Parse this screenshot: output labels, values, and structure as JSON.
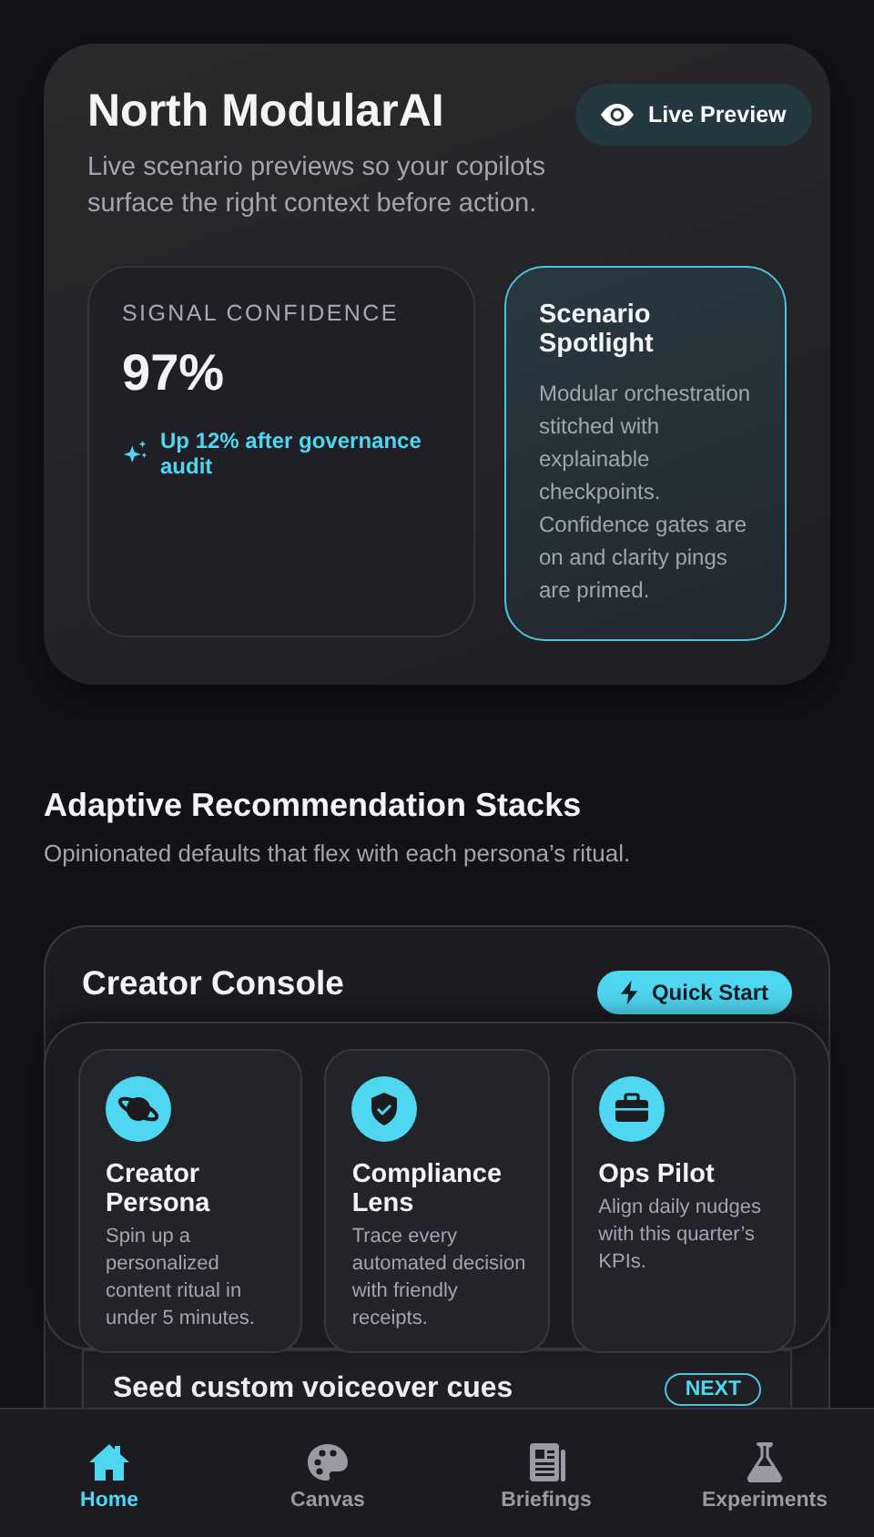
{
  "header": {
    "title": "North ModularAI",
    "subtitle": "Live scenario previews so your copilots surface the right context before action.",
    "action": {
      "label": "Live Preview"
    }
  },
  "metric": {
    "label": "SIGNAL CONFIDENCE",
    "value": "97%",
    "trend": "Up 12% after governance audit"
  },
  "spotlight": {
    "title": "Scenario Spotlight",
    "body": "Modular orchestration stitched with explainable checkpoints. Confidence gates are on and clarity pings are primed."
  },
  "section": {
    "title": "Adaptive Recommendation Stacks",
    "subtitle": "Opinionated defaults that flex with each persona’s ritual."
  },
  "console": {
    "title": "Creator Console",
    "action": {
      "label": "Quick Start"
    },
    "personas": [
      {
        "title": "Creator Persona",
        "description": "Spin up a personalized content ritual in under 5 minutes."
      },
      {
        "title": "Compliance Lens",
        "description": "Trace every automated decision with friendly receipts."
      },
      {
        "title": "Ops Pilot",
        "description": "Align daily nudges with this quarter’s KPIs."
      }
    ],
    "steps": [
      {
        "label": "Seed custom voiceover cues",
        "badge": "NEXT"
      }
    ]
  },
  "nav": [
    {
      "label": "Home",
      "selected": true
    },
    {
      "label": "Canvas",
      "selected": false
    },
    {
      "label": "Briefings",
      "selected": false
    },
    {
      "label": "Experiments",
      "selected": false
    }
  ]
}
